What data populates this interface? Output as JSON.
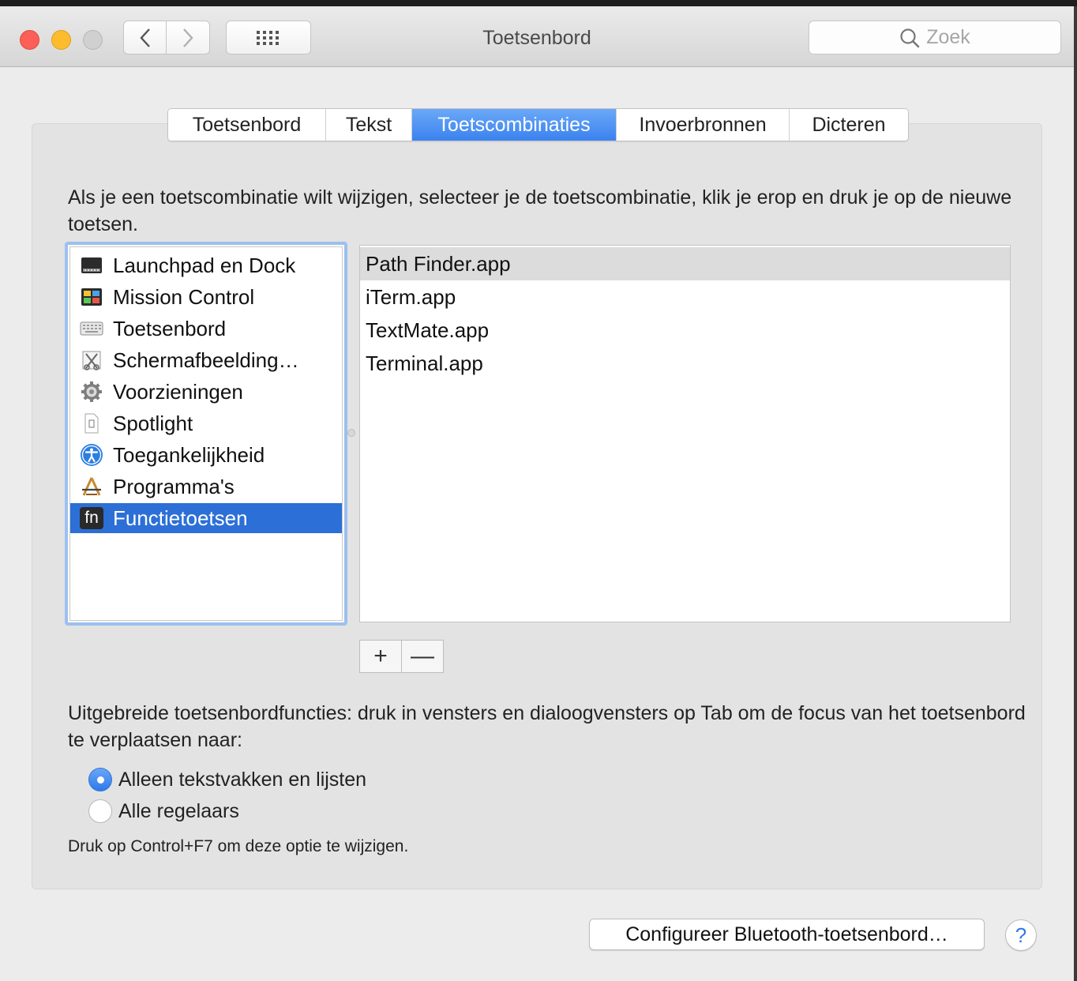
{
  "window": {
    "title": "Toetsenbord",
    "search_placeholder": "Zoek"
  },
  "tabs": [
    {
      "label": "Toetsenbord",
      "active": false
    },
    {
      "label": "Tekst",
      "active": false
    },
    {
      "label": "Toetscombinaties",
      "active": true
    },
    {
      "label": "Invoerbronnen",
      "active": false
    },
    {
      "label": "Dicteren",
      "active": false
    }
  ],
  "instruction": "Als je een toetscombinatie wilt wijzigen, selecteer je de toetscombinatie, klik je erop en druk je op de nieuwe toetsen.",
  "categories": [
    {
      "label": "Launchpad en Dock",
      "icon": "launchpad-dock-icon"
    },
    {
      "label": "Mission Control",
      "icon": "mission-control-icon"
    },
    {
      "label": "Toetsenbord",
      "icon": "keyboard-icon"
    },
    {
      "label": "Schermafbeelding…",
      "icon": "screenshot-icon"
    },
    {
      "label": "Voorzieningen",
      "icon": "gear-icon"
    },
    {
      "label": "Spotlight",
      "icon": "spotlight-document-icon"
    },
    {
      "label": "Toegankelijkheid",
      "icon": "accessibility-icon"
    },
    {
      "label": "Programma's",
      "icon": "applications-icon"
    },
    {
      "label": "Functietoetsen",
      "icon": "fn-key-icon",
      "icon_text": "fn",
      "selected": true
    }
  ],
  "apps": [
    {
      "label": "Path Finder.app",
      "selected": true
    },
    {
      "label": "iTerm.app"
    },
    {
      "label": "TextMate.app"
    },
    {
      "label": "Terminal.app"
    }
  ],
  "buttons": {
    "add": "+",
    "remove": "—",
    "bluetooth": "Configureer Bluetooth-toetsenbord…",
    "help": "?"
  },
  "keyboard_access": {
    "description": "Uitgebreide toetsenbordfuncties: druk in vensters en dialoogvensters op Tab om de focus van het toetsenbord te verplaatsen naar:",
    "options": [
      {
        "label": "Alleen tekstvakken en lijsten",
        "selected": true
      },
      {
        "label": "Alle regelaars",
        "selected": false
      }
    ],
    "hint": "Druk op Control+F7 om deze optie te wijzigen."
  },
  "colors": {
    "accent": "#3b82ef",
    "selection": "#2c6fd6"
  }
}
